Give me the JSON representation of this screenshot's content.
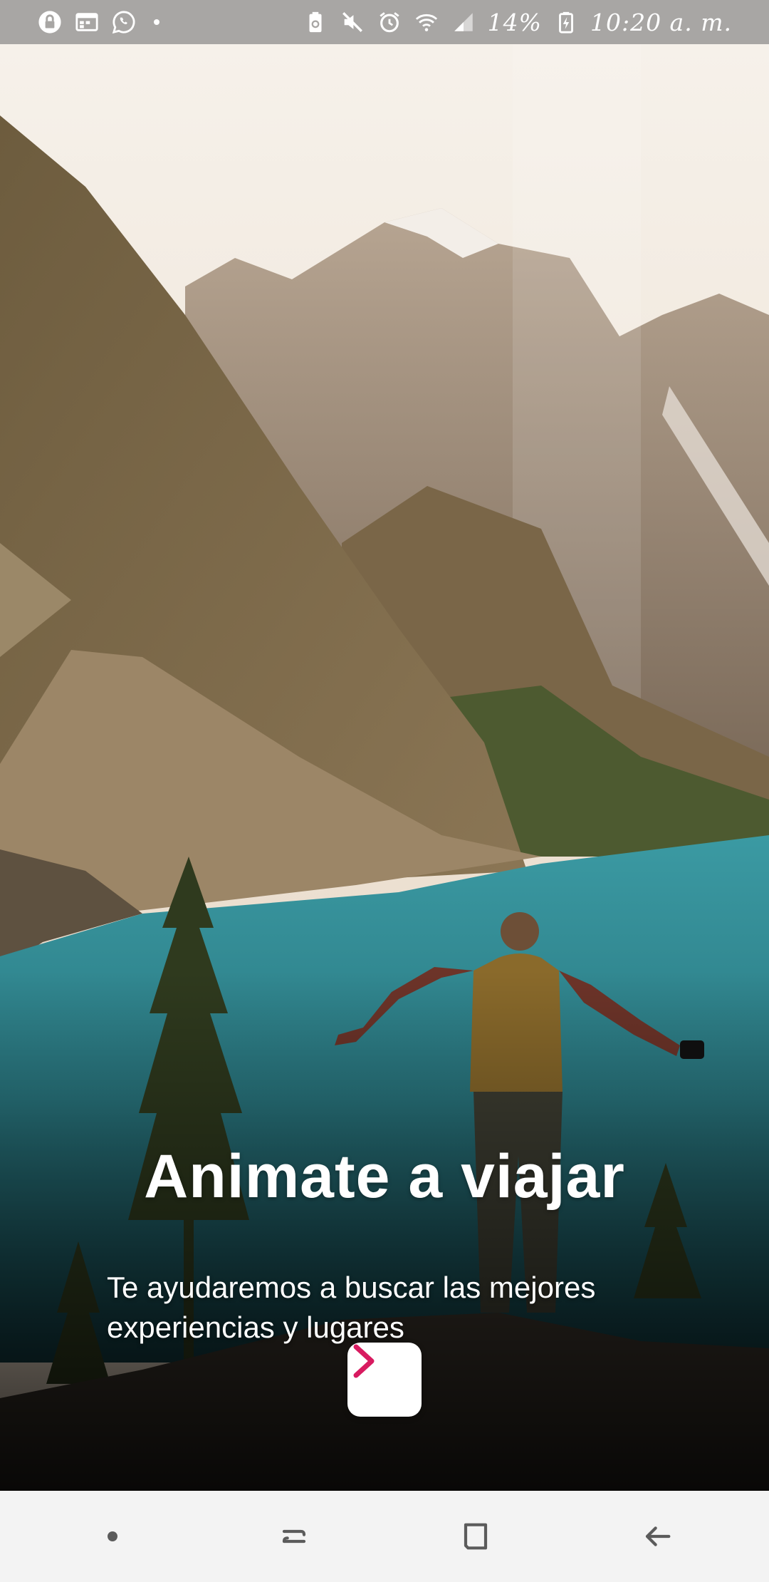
{
  "status_bar": {
    "left_icons": [
      "lock-icon",
      "calendar-icon",
      "whatsapp-icon"
    ],
    "right_icons": [
      "recycle-battery-icon",
      "mute-icon",
      "alarm-icon",
      "wifi-icon",
      "signal-icon",
      "battery-charging-icon"
    ],
    "battery": "14%",
    "time": "10:20 a. m."
  },
  "hero": {
    "title": "Animate a viajar",
    "subtitle": "Te ayudaremos a buscar las mejores\n experiencias y lugares",
    "next_icon": "chevron-right-icon",
    "accent_color": "#d81b60"
  },
  "nav_bar": {
    "buttons": [
      "dot-icon",
      "recent-apps-icon",
      "home-icon",
      "back-icon"
    ]
  }
}
